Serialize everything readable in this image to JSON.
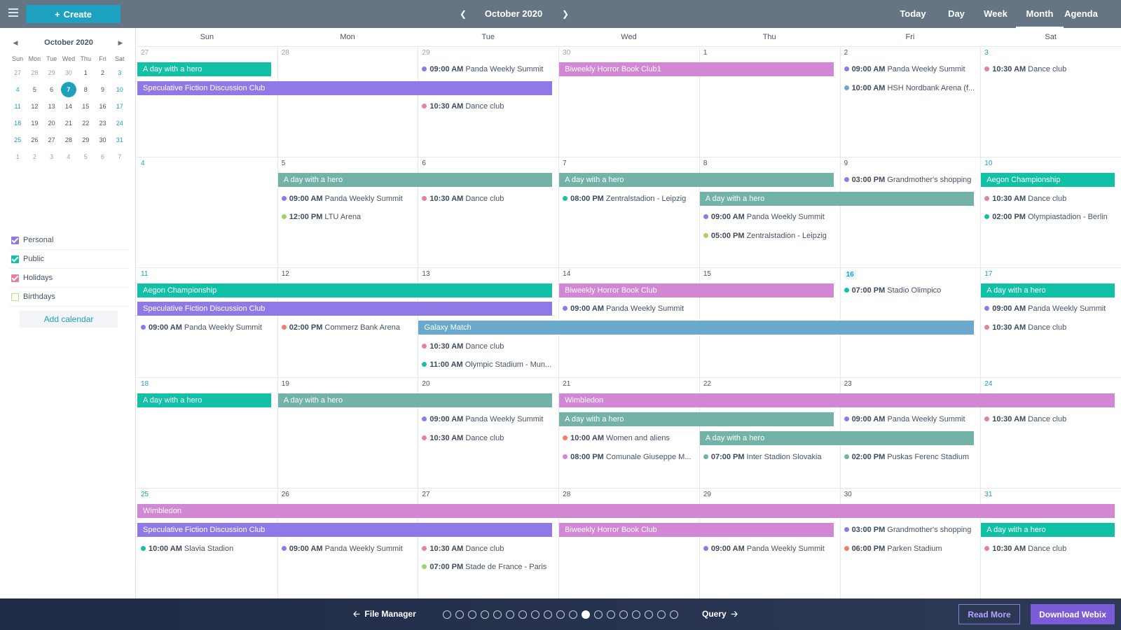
{
  "toolbar": {
    "create_label": "Create",
    "title": "October 2020",
    "modes": [
      "Today",
      "Day",
      "Week",
      "Month",
      "Agenda"
    ],
    "active_mode": "Month"
  },
  "sidebar": {
    "mini_title": "October 2020",
    "weekdays": [
      "Sun",
      "Mon",
      "Tue",
      "Wed",
      "Thu",
      "Fri",
      "Sat"
    ],
    "weeks": [
      [
        "27",
        "28",
        "29",
        "30",
        "1",
        "2",
        "3"
      ],
      [
        "4",
        "5",
        "6",
        "7",
        "8",
        "9",
        "10"
      ],
      [
        "11",
        "12",
        "13",
        "14",
        "15",
        "16",
        "17"
      ],
      [
        "18",
        "19",
        "20",
        "21",
        "22",
        "23",
        "24"
      ],
      [
        "25",
        "26",
        "27",
        "28",
        "29",
        "30",
        "31"
      ],
      [
        "1",
        "2",
        "3",
        "4",
        "5",
        "6",
        "7"
      ]
    ],
    "selected_day": "7",
    "calendars": [
      {
        "label": "Personal",
        "color": "#8c79e0",
        "checked": true
      },
      {
        "label": "Public",
        "color": "#10c1a6",
        "checked": true
      },
      {
        "label": "Holidays",
        "color": "#e4829b",
        "checked": true
      },
      {
        "label": "Birthdays",
        "color": "#b8e27a",
        "checked": false
      }
    ],
    "add_calendar_label": "Add calendar"
  },
  "month": {
    "weekdays": [
      "Sun",
      "Mon",
      "Tue",
      "Wed",
      "Thu",
      "Fri",
      "Sat"
    ],
    "weeks": [
      [
        "27",
        "28",
        "29",
        "30",
        "1",
        "2",
        "3"
      ],
      [
        "4",
        "5",
        "6",
        "7",
        "8",
        "9",
        "10"
      ],
      [
        "11",
        "12",
        "13",
        "14",
        "15",
        "16",
        "17"
      ],
      [
        "18",
        "19",
        "20",
        "21",
        "22",
        "23",
        "24"
      ],
      [
        "25",
        "26",
        "27",
        "28",
        "29",
        "30",
        "31"
      ]
    ],
    "today": "16",
    "bars": [
      {
        "week": 0,
        "start": 0,
        "span": 1,
        "slot": 0,
        "text": "A day with a hero",
        "color": "#10c1a6"
      },
      {
        "week": 0,
        "start": 0,
        "span": 3,
        "slot": 1,
        "text": "Speculative Fiction Discussion Club",
        "color": "#9079e6"
      },
      {
        "week": 0,
        "start": 3,
        "span": 2,
        "slot": 0,
        "text": "Biweekly Horror Book Club1",
        "color": "#d287d4"
      },
      {
        "week": 1,
        "start": 1,
        "span": 2,
        "slot": 0,
        "text": "A day with a hero",
        "color": "#73b2a6"
      },
      {
        "week": 1,
        "start": 3,
        "span": 2,
        "slot": 0,
        "text": "A day with a hero",
        "color": "#73b2a6"
      },
      {
        "week": 1,
        "start": 4,
        "span": 2,
        "slot": 1,
        "text": "A day with a hero",
        "color": "#73b2a6"
      },
      {
        "week": 1,
        "start": 6,
        "span": 1,
        "slot": 0,
        "text": "Aegon Championship",
        "color": "#10c1a6"
      },
      {
        "week": 2,
        "start": 0,
        "span": 3,
        "slot": 0,
        "text": "Aegon Championship",
        "color": "#10c1a6"
      },
      {
        "week": 2,
        "start": 0,
        "span": 3,
        "slot": 1,
        "text": "Speculative Fiction Discussion Club",
        "color": "#9079e6"
      },
      {
        "week": 2,
        "start": 3,
        "span": 2,
        "slot": 0,
        "text": "Biweekly Horror Book Club",
        "color": "#d287d4"
      },
      {
        "week": 2,
        "start": 2,
        "span": 4,
        "slot": 2,
        "text": "Galaxy Match",
        "color": "#6aa8cc"
      },
      {
        "week": 2,
        "start": 6,
        "span": 1,
        "slot": 0,
        "text": "A day with a hero",
        "color": "#10c1a6"
      },
      {
        "week": 3,
        "start": 0,
        "span": 1,
        "slot": 0,
        "text": "A day with a hero",
        "color": "#10c1a6"
      },
      {
        "week": 3,
        "start": 1,
        "span": 2,
        "slot": 0,
        "text": "A day with a hero",
        "color": "#73b2a6"
      },
      {
        "week": 3,
        "start": 3,
        "span": 4,
        "slot": 0,
        "text": "Wimbledon",
        "color": "#d287d4"
      },
      {
        "week": 3,
        "start": 3,
        "span": 2,
        "slot": 1,
        "text": "A day with a hero",
        "color": "#73b2a6"
      },
      {
        "week": 3,
        "start": 4,
        "span": 2,
        "slot": 2,
        "text": "A day with a hero",
        "color": "#73b2a6"
      },
      {
        "week": 4,
        "start": 0,
        "span": 7,
        "slot": 0,
        "text": "Wimbledon",
        "color": "#d287d4"
      },
      {
        "week": 4,
        "start": 0,
        "span": 3,
        "slot": 1,
        "text": "Speculative Fiction Discussion Club",
        "color": "#9079e6"
      },
      {
        "week": 4,
        "start": 3,
        "span": 2,
        "slot": 1,
        "text": "Biweekly Horror Book Club",
        "color": "#d287d4"
      },
      {
        "week": 4,
        "start": 6,
        "span": 1,
        "slot": 1,
        "text": "A day with a hero",
        "color": "#10c1a6"
      }
    ],
    "events": [
      {
        "week": 0,
        "day": 2,
        "slot": 0,
        "time": "09:00 AM",
        "text": "Panda Weekly Summit",
        "color": "#9079e6"
      },
      {
        "week": 0,
        "day": 2,
        "slot": 2,
        "time": "10:30 AM",
        "text": "Dance club",
        "color": "#e4829b"
      },
      {
        "week": 0,
        "day": 5,
        "slot": 0,
        "time": "09:00 AM",
        "text": "Panda Weekly Summit",
        "color": "#9079e6"
      },
      {
        "week": 0,
        "day": 5,
        "slot": 1,
        "time": "10:00 AM",
        "text": "HSH Nordbank Arena (f...",
        "color": "#6aa8cc"
      },
      {
        "week": 0,
        "day": 6,
        "slot": 0,
        "time": "10:30 AM",
        "text": "Dance club",
        "color": "#e4829b"
      },
      {
        "week": 1,
        "day": 1,
        "slot": 1,
        "time": "09:00 AM",
        "text": "Panda Weekly Summit",
        "color": "#9079e6"
      },
      {
        "week": 1,
        "day": 1,
        "slot": 2,
        "time": "12:00 PM",
        "text": "LTU Arena",
        "color": "#9fd46a"
      },
      {
        "week": 1,
        "day": 2,
        "slot": 1,
        "time": "10:30 AM",
        "text": "Dance club",
        "color": "#e4829b"
      },
      {
        "week": 1,
        "day": 3,
        "slot": 1,
        "time": "08:00 PM",
        "text": "Zentralstadion - Leipzig",
        "color": "#10c1a6"
      },
      {
        "week": 1,
        "day": 4,
        "slot": 2,
        "time": "09:00 AM",
        "text": "Panda Weekly Summit",
        "color": "#9079e6"
      },
      {
        "week": 1,
        "day": 4,
        "slot": 3,
        "time": "05:00 PM",
        "text": "Zentralstadion - Leipzig",
        "color": "#9fd46a"
      },
      {
        "week": 1,
        "day": 5,
        "slot": 0,
        "time": "03:00 PM",
        "text": "Grandmother's shopping",
        "color": "#9079e6"
      },
      {
        "week": 1,
        "day": 6,
        "slot": 1,
        "time": "10:30 AM",
        "text": "Dance club",
        "color": "#e4829b"
      },
      {
        "week": 1,
        "day": 6,
        "slot": 2,
        "time": "02:00 PM",
        "text": "Olympiastadion - Berlin",
        "color": "#10c1a6"
      },
      {
        "week": 2,
        "day": 0,
        "slot": 2,
        "time": "09:00 AM",
        "text": "Panda Weekly Summit",
        "color": "#9079e6"
      },
      {
        "week": 2,
        "day": 1,
        "slot": 2,
        "time": "02:00 PM",
        "text": "Commerz Bank Arena",
        "color": "#f0806a"
      },
      {
        "week": 2,
        "day": 2,
        "slot": 3,
        "time": "10:30 AM",
        "text": "Dance club",
        "color": "#e4829b"
      },
      {
        "week": 2,
        "day": 2,
        "slot": 4,
        "time": "11:00 AM",
        "text": "Olympic Stadium - Mun...",
        "color": "#10c1a6"
      },
      {
        "week": 2,
        "day": 3,
        "slot": 1,
        "time": "09:00 AM",
        "text": "Panda Weekly Summit",
        "color": "#9079e6"
      },
      {
        "week": 2,
        "day": 5,
        "slot": 0,
        "time": "07:00 PM",
        "text": "Stadio Olimpico",
        "color": "#10c1a6"
      },
      {
        "week": 2,
        "day": 6,
        "slot": 1,
        "time": "09:00 AM",
        "text": "Panda Weekly Summit",
        "color": "#9079e6"
      },
      {
        "week": 2,
        "day": 6,
        "slot": 2,
        "time": "10:30 AM",
        "text": "Dance club",
        "color": "#e4829b"
      },
      {
        "week": 3,
        "day": 2,
        "slot": 1,
        "time": "09:00 AM",
        "text": "Panda Weekly Summit",
        "color": "#9079e6"
      },
      {
        "week": 3,
        "day": 2,
        "slot": 2,
        "time": "10:30 AM",
        "text": "Dance club",
        "color": "#e4829b"
      },
      {
        "week": 3,
        "day": 3,
        "slot": 2,
        "time": "10:00 AM",
        "text": "Women and aliens",
        "color": "#f0806a"
      },
      {
        "week": 3,
        "day": 3,
        "slot": 3,
        "time": "08:00 PM",
        "text": "Comunale Giuseppe M...",
        "color": "#d287d4"
      },
      {
        "week": 3,
        "day": 4,
        "slot": 3,
        "time": "07:00 PM",
        "text": "Inter Stadion Slovakia",
        "color": "#73b2a6"
      },
      {
        "week": 3,
        "day": 5,
        "slot": 1,
        "time": "09:00 AM",
        "text": "Panda Weekly Summit",
        "color": "#9079e6"
      },
      {
        "week": 3,
        "day": 5,
        "slot": 3,
        "time": "02:00 PM",
        "text": "Puskas Ferenc Stadium",
        "color": "#73b2a6"
      },
      {
        "week": 3,
        "day": 6,
        "slot": 1,
        "time": "10:30 AM",
        "text": "Dance club",
        "color": "#e4829b"
      },
      {
        "week": 4,
        "day": 0,
        "slot": 2,
        "time": "10:00 AM",
        "text": "Slavia Stadion",
        "color": "#10c1a6"
      },
      {
        "week": 4,
        "day": 1,
        "slot": 2,
        "time": "09:00 AM",
        "text": "Panda Weekly Summit",
        "color": "#9079e6"
      },
      {
        "week": 4,
        "day": 2,
        "slot": 2,
        "time": "10:30 AM",
        "text": "Dance club",
        "color": "#e4829b"
      },
      {
        "week": 4,
        "day": 2,
        "slot": 3,
        "time": "07:00 PM",
        "text": "Stade de France - Paris",
        "color": "#9fd46a"
      },
      {
        "week": 4,
        "day": 4,
        "slot": 2,
        "time": "09:00 AM",
        "text": "Panda Weekly Summit",
        "color": "#9079e6"
      },
      {
        "week": 4,
        "day": 5,
        "slot": 1,
        "time": "03:00 PM",
        "text": "Grandmother's shopping",
        "color": "#9079e6"
      },
      {
        "week": 4,
        "day": 5,
        "slot": 2,
        "time": "06:00 PM",
        "text": "Parken Stadium",
        "color": "#f0806a"
      },
      {
        "week": 4,
        "day": 6,
        "slot": 2,
        "time": "10:30 AM",
        "text": "Dance club",
        "color": "#e4829b"
      }
    ]
  },
  "bottombar": {
    "prev_label": "File Manager",
    "next_label": "Query",
    "dot_count": 19,
    "active_dot": 11,
    "read_more": "Read More",
    "download": "Download Webix"
  }
}
